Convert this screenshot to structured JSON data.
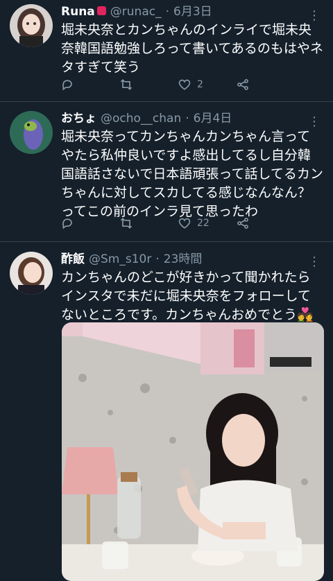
{
  "tweets": [
    {
      "name": "Runa",
      "handle": "@runac_",
      "sep": "·",
      "date": "6月3日",
      "text": "堀未央奈とカンちゃんのインライで堀未央奈韓国語勉強しろって書いてあるのもはやネタすぎて笑う",
      "likes": "2"
    },
    {
      "name": "おちょ",
      "handle": "@ocho__chan",
      "sep": "·",
      "date": "6月4日",
      "text": "堀未央奈ってカンちゃんカンちゃん言ってやたら私仲良いですよ感出してるし自分韓国語話さないで日本語頑張って話してるカンちゃんに対してスカしてる感じなんなん？ってこの前のインラ見て思ったわ",
      "likes": "22"
    },
    {
      "name": "酢飯",
      "handle": "@Sm_s10r",
      "sep": "·",
      "date": "23時間",
      "text": "カンちゃんのどこが好きかって聞かれたらインスタで未だに堀未央奈をフォローしてないところです。カンちゃんおめでとう💑"
    }
  ],
  "colors": {
    "background": "#15202b",
    "secondary": "#8899a6",
    "divider": "#38444d"
  }
}
